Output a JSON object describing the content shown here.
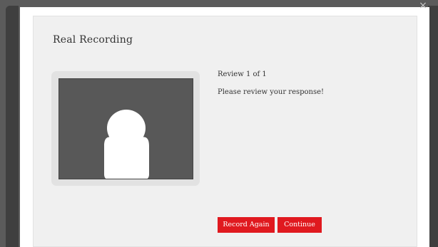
{
  "dialog": {
    "close_glyph": "×",
    "title": "Real Recording"
  },
  "review": {
    "counter": "Review 1 of 1",
    "message": "Please review your response!"
  },
  "video": {
    "placeholder_icon": "user-silhouette-icon"
  },
  "actions": {
    "record_again_label": "Record Again",
    "continue_label": "Continue"
  },
  "colors": {
    "accent": "#e0191f",
    "panel_bg": "#f0f0f0",
    "video_bg": "#585858"
  }
}
